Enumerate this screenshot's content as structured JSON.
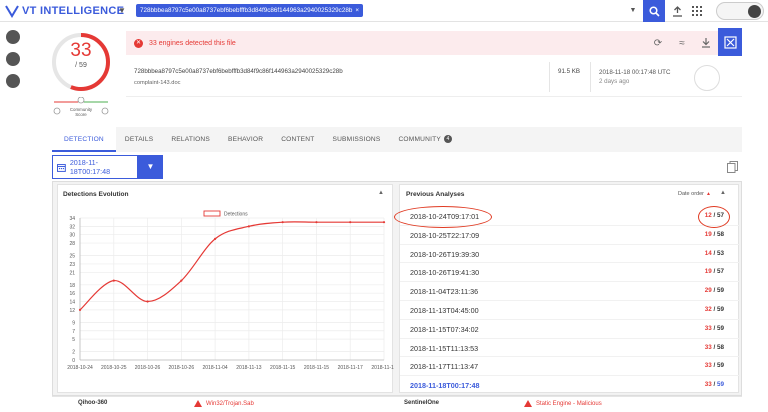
{
  "app": {
    "logo_text": "VT INTELLIGENCE",
    "search_chip": "728bbbea8797c5e00a8737ebf6bebfffb3d84f9c86f144963a2940025329c28b",
    "chip_close": "×"
  },
  "colors": {
    "accent": "#3b5bdb",
    "danger": "#e53935",
    "annotation": "#e03a22"
  },
  "score": {
    "positives": "33",
    "total": "/ 59",
    "community_label_1": "Community",
    "community_label_2": "Score"
  },
  "banner": {
    "text": "33 engines detected this file",
    "icon": "error-x-icon"
  },
  "file": {
    "hash": "728bbbea8797c5e00a8737ebf6bebfffb3d84f9c86f144963a2940025329c28b",
    "name": "complaint-143.doc",
    "size": "91.5 KB",
    "date": "2018-11-18 00:17:48 UTC",
    "date_relative": "2 days ago"
  },
  "tabs": [
    {
      "label": "DETECTION"
    },
    {
      "label": "DETAILS"
    },
    {
      "label": "RELATIONS"
    },
    {
      "label": "BEHAVIOR"
    },
    {
      "label": "CONTENT"
    },
    {
      "label": "SUBMISSIONS"
    },
    {
      "label": "COMMUNITY"
    }
  ],
  "community_count": "4",
  "date_selector": {
    "value": "2018-11-18T00:17:48"
  },
  "evolution": {
    "title": "Detections Evolution",
    "caret": "▲"
  },
  "previous": {
    "title": "Previous Analyses",
    "order_label": "Date order",
    "sort_icon": "▲",
    "caret": "▲"
  },
  "analyses": [
    {
      "date": "2018-10-24T09:17:01",
      "pos": "12",
      "tot": "57"
    },
    {
      "date": "2018-10-25T22:17:09",
      "pos": "19",
      "tot": "58"
    },
    {
      "date": "2018-10-26T19:39:30",
      "pos": "14",
      "tot": "53"
    },
    {
      "date": "2018-10-26T19:41:30",
      "pos": "19",
      "tot": "57"
    },
    {
      "date": "2018-11-04T23:11:36",
      "pos": "29",
      "tot": "59"
    },
    {
      "date": "2018-11-13T04:45:00",
      "pos": "32",
      "tot": "59"
    },
    {
      "date": "2018-11-15T07:34:02",
      "pos": "33",
      "tot": "59"
    },
    {
      "date": "2018-11-15T11:13:53",
      "pos": "33",
      "tot": "58"
    },
    {
      "date": "2018-11-17T11:13:47",
      "pos": "33",
      "tot": "59"
    },
    {
      "date": "2018-11-18T00:17:48",
      "pos": "33",
      "tot": "59"
    }
  ],
  "engines": [
    {
      "name": "Qihoo-360",
      "result": "Win32/Trojan.Sab"
    },
    {
      "name": "SentinelOne",
      "result": "Static Engine - Malicious"
    }
  ],
  "chart_data": {
    "type": "line",
    "title": "",
    "xlabel": "",
    "ylabel": "",
    "legend": "Detections",
    "legend_position": "top-center",
    "categories": [
      "2018-10-24",
      "2018-10-25",
      "2018-10-26",
      "2018-10-26",
      "2018-11-04",
      "2018-11-13",
      "2018-11-15",
      "2018-11-15",
      "2018-11-17",
      "2018-11-18"
    ],
    "series": [
      {
        "name": "Detections",
        "values": [
          12,
          19,
          14,
          19,
          29,
          32,
          33,
          33,
          33,
          33
        ]
      }
    ],
    "yticks": [
      0,
      2,
      5,
      7,
      9,
      12,
      14,
      16,
      18,
      21,
      23,
      25,
      28,
      30,
      32,
      34
    ],
    "ylim": [
      0,
      34
    ],
    "grid": true,
    "color": "#e53935"
  }
}
